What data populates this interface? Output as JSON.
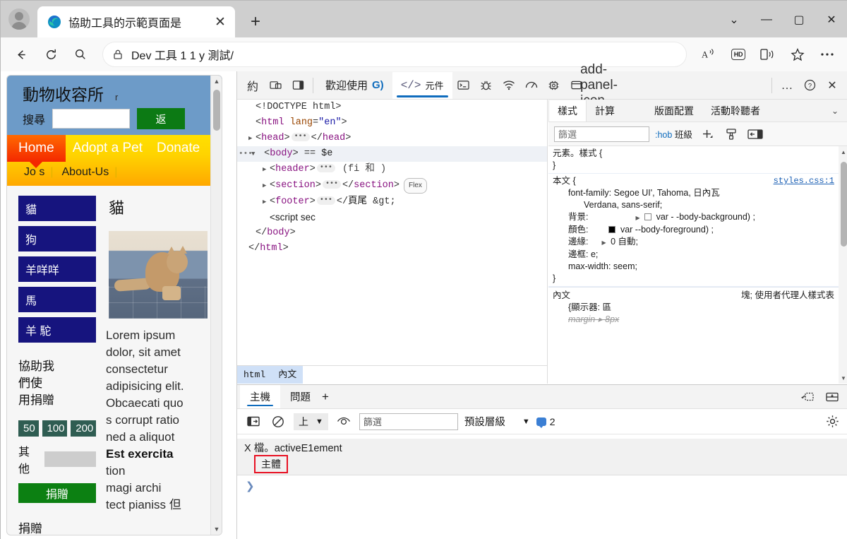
{
  "browser": {
    "tab": {
      "title": "協助工具的示範頁面是",
      "favicon": "edge-logo-icon",
      "close_label": "✕"
    },
    "new_tab_label": "+",
    "window_controls": {
      "more": "⌄",
      "minimize": "—",
      "maximize": "▢",
      "close": "✕"
    },
    "nav": {
      "back": "←",
      "reload": "⟳",
      "search": "search-icon"
    },
    "url": {
      "value": "Dev 工具 1 1 y 測試/",
      "lock": "lock-icon"
    },
    "actions": [
      "read-aloud-icon",
      "HD",
      "split-screen-icon",
      "favorite-icon",
      "settings-more-icon"
    ]
  },
  "page": {
    "header": {
      "title": "動物收容所",
      "title_suffix": "r",
      "search_label": "搜尋",
      "search_value": "",
      "back_button": "返"
    },
    "nav": {
      "primary": [
        "Home",
        "Adopt a Pet",
        "Donate"
      ],
      "secondary": [
        "Jo s",
        "About-Us"
      ]
    },
    "animals": [
      "貓",
      "狗",
      "羊咩咩",
      "馬",
      "羊 駝"
    ],
    "donation": {
      "help_text": "協助我\n們使\n用捐贈",
      "amounts": [
        "50",
        "100",
        "200"
      ],
      "other_label": "其他",
      "other_value": "",
      "donate_button": "捐贈",
      "footer": "捐贈"
    },
    "content": {
      "title": "貓",
      "image_alt": "cat-photo",
      "paragraph_lines": [
        {
          "text": "Lorem ipsum",
          "bold": false
        },
        {
          "text": "dolor, sit amet",
          "bold": false
        },
        {
          "text": "consectetur",
          "bold": false
        },
        {
          "text": "adipisicing elit.",
          "bold": false
        },
        {
          "text": "Obcaecati quo",
          "bold": false
        },
        {
          "text": "s corrupt ratio",
          "bold": false
        },
        {
          "text": "ned a aliquot",
          "bold": false
        },
        {
          "text": "Est exercita",
          "bold": true
        },
        {
          "text": "tion",
          "bold": false
        },
        {
          "text": "magi archi",
          "bold": false
        },
        {
          "text": "tect pianiss 但",
          "bold": false
        }
      ]
    }
  },
  "devtools": {
    "toolbar": {
      "left_items": [
        "約",
        "dock-side-icon",
        "device-panel-icon"
      ],
      "welcome_tab": "歡迎使用",
      "welcome_badge": "G)",
      "elements_tab": "元件",
      "elements_tag_icon": "</>",
      "right_icons": [
        "console-icon",
        "debugger-icon",
        "network-icon",
        "performance-icon",
        "memory-icon",
        "application-icon",
        "add-panel-icon"
      ],
      "overflow": "…",
      "help": "?",
      "close": "✕"
    },
    "dom": {
      "lines": [
        {
          "indent": 1,
          "html": "&lt;!DOCTYPE html&gt;",
          "selected": false
        },
        {
          "indent": 1,
          "html": "&lt;html lang=\"en\"&gt;",
          "selected": false
        },
        {
          "indent": 1,
          "html": "&lt;head&gt; … &lt;/head&gt;",
          "selected": false
        },
        {
          "indent": 1,
          "html": "&lt;body&gt; == $e",
          "selected": true
        },
        {
          "indent": 2,
          "html": "&lt;header&gt; … (fi 和 )",
          "selected": false
        },
        {
          "indent": 2,
          "html": "&lt;section&gt; … &lt;/section&gt;",
          "selected": false,
          "badge": "Flex"
        },
        {
          "indent": 2,
          "html": "&lt;footer&gt; … &lt;/ 頁尾 &gt;",
          "selected": false
        },
        {
          "indent": 2,
          "html": "&lt;script sec",
          "selected": false
        },
        {
          "indent": 1,
          "html": "&lt;/body&gt;",
          "selected": false
        },
        {
          "indent": 0,
          "html": "&lt;/html&gt;",
          "selected": false
        }
      ],
      "breadcrumb": [
        "html",
        "內文"
      ]
    },
    "styles": {
      "tabs": [
        "樣式",
        "計算",
        "版面配置",
        "活動聆聽者"
      ],
      "active_tab": "樣式",
      "chevron": "⌄",
      "filter_placeholder": "篩選",
      "hov_label": ":hob 班級",
      "icons": [
        "new-rule-icon",
        "style-paint-icon",
        "toggle-sidebar-icon"
      ],
      "rules": [
        {
          "selector": "元素。樣式 {",
          "source": "",
          "props": [],
          "close": "}"
        },
        {
          "selector": "本文 {",
          "source": "styles.css:1",
          "props": [
            {
              "name": "font-family:",
              "value": "Segoe            UI',    Tahoma,   日內瓦"
            },
            {
              "name": "",
              "value": "Verdana,  sans-serif;"
            },
            {
              "name": "背景:",
              "value": "var - -body-background) ;",
              "swatch": "white",
              "expand": true
            },
            {
              "name": "顏色:",
              "value": "var --body-foreground) ;",
              "swatch": "black"
            },
            {
              "name": "邊緣:",
              "value": "0  自動;",
              "expand": true
            },
            {
              "name": "邊框:",
              "value": "e;"
            },
            {
              "name": "max-width:",
              "value": "seem;"
            }
          ],
          "close": "}"
        }
      ],
      "ua_section": {
        "selector": "內文",
        "right": "塊; 使用者代理人樣式表",
        "line1": "{顯示器: 區",
        "line2": "margin-▸ 8px"
      }
    },
    "drawer": {
      "tabs": [
        "主機",
        "問題"
      ],
      "active_tab": "主機",
      "add_label": "+",
      "right_icons": [
        "restore-drawer-icon",
        "dock-bottom-icon"
      ],
      "console": {
        "toolbar_icons": [
          "sidebar-toggle-icon",
          "clear-console-icon",
          "eye-icon"
        ],
        "context_value": "上",
        "context_caret": "▼",
        "filter_placeholder": "篩選",
        "filter_value": "篩選",
        "level_label": "預設層級",
        "level_caret": "▼",
        "message_count": "2",
        "settings_icon": "gear-icon",
        "output_line": "X 檔。activeE1ement",
        "highlight_value": "主體",
        "prompt": "❯"
      }
    }
  }
}
